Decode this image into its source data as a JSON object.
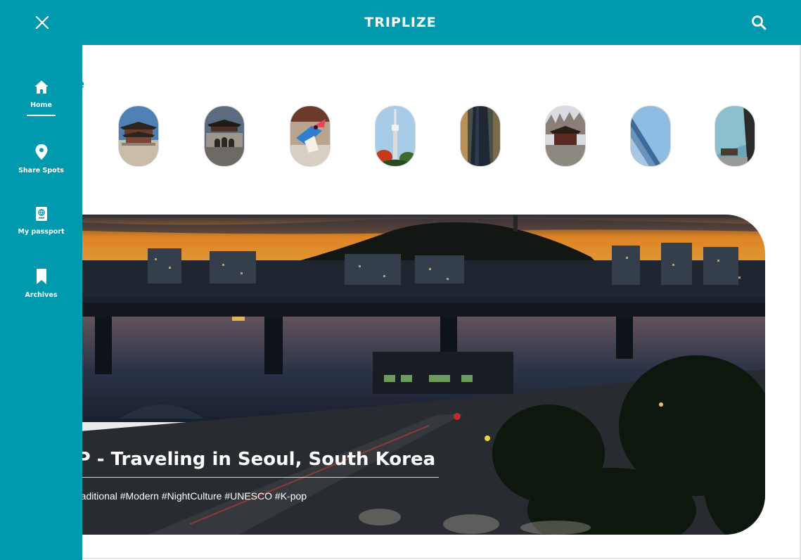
{
  "app": {
    "title": "TRIPLIZE"
  },
  "header": {
    "close_icon": "close-icon",
    "search_icon": "search-icon"
  },
  "sidebar": {
    "items": [
      {
        "label": "Home",
        "icon": "home-icon",
        "active": true
      },
      {
        "label": "Share Spots",
        "icon": "location-pin-icon",
        "active": false
      },
      {
        "label": "My passport",
        "icon": "passport-icon",
        "active": false
      },
      {
        "label": "Archives",
        "icon": "bookmark-icon",
        "active": false
      }
    ]
  },
  "main": {
    "section_title": "e",
    "thumbnails": [
      {
        "name": "gyeongbokgung-palace"
      },
      {
        "name": "gwanghwamun-gate"
      },
      {
        "name": "traditional-dance"
      },
      {
        "name": "n-seoul-tower"
      },
      {
        "name": "skyscraper-night"
      },
      {
        "name": "pavilion-winter"
      },
      {
        "name": "glass-tower"
      },
      {
        "name": "palace-glass-reflection"
      }
    ],
    "hero": {
      "title": "IP - Traveling in Seoul, South Korea",
      "tags": "raditional #Modern #NightCulture #UNESCO #K-pop"
    }
  },
  "colors": {
    "brand": "#0099AE",
    "text_on_brand": "#FFFFFF"
  }
}
